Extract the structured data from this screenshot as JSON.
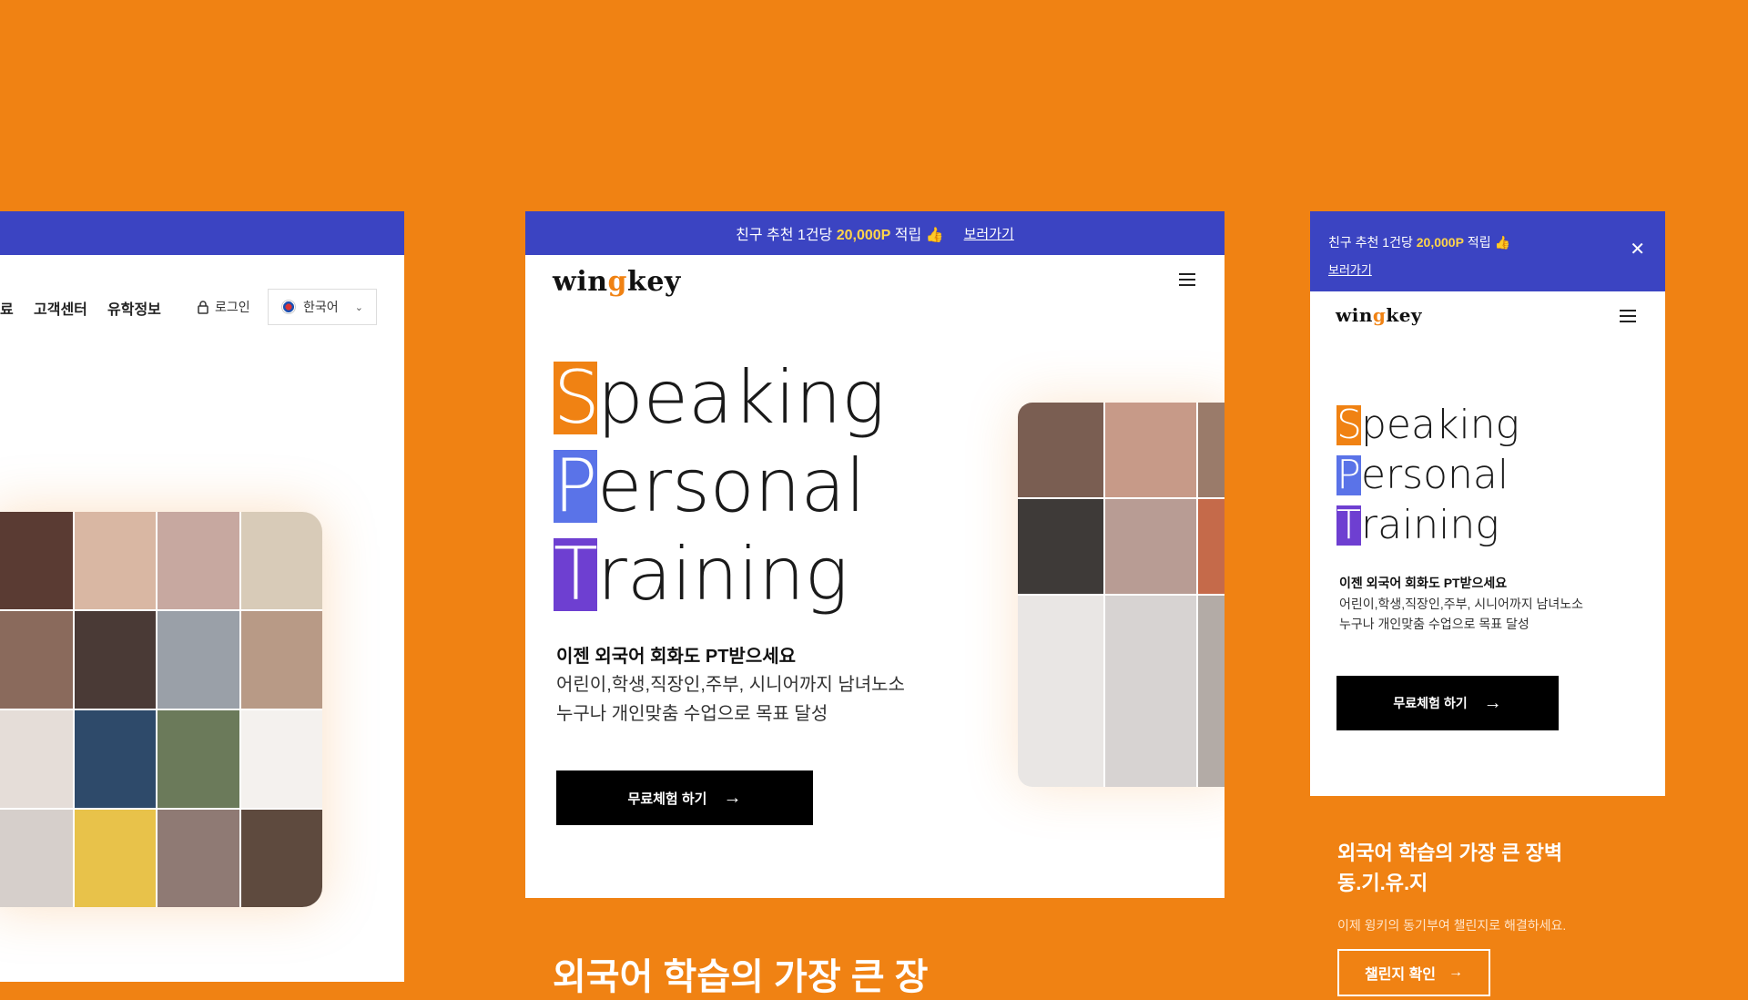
{
  "colors": {
    "accent_orange": "#F08213",
    "banner_blue": "#3B44C2",
    "cap_orange": "#F08213",
    "cap_blue": "#5A73E8",
    "cap_purple": "#6E3FD1",
    "highlight_yellow": "#FFD54A"
  },
  "left_panel": {
    "nav": [
      "료",
      "고객센터",
      "유학정보"
    ],
    "login_label": "로그인",
    "lang_label": "한국어"
  },
  "center_panel": {
    "banner": {
      "text_before": "친구 추천 1건당 ",
      "amount": "20,000P",
      "text_after": " 적립 👍",
      "link": "보러가기"
    },
    "logo": {
      "pre": "win",
      "mid": "g",
      "post": "key"
    },
    "hero": {
      "line1_cap": "S",
      "line1_rest": "peaking",
      "line2_cap": "P",
      "line2_rest": "ersonal",
      "line3_cap": "T",
      "line3_rest": "raining"
    },
    "subtitle": "이젠 외국어 회화도 PT받으세요",
    "desc1": "어린이,학생,직장인,주부, 시니어까지 남녀노소",
    "desc2": "누구나 개인맞춤 수업으로 목표 달성",
    "cta": "무료체험 하기",
    "bottom_title": "외국어 학습의 가장 큰 장"
  },
  "right_panel": {
    "banner": {
      "text_before": "친구 추천 1건당 ",
      "amount": "20,000P",
      "text_after": " 적립 👍",
      "link": "보러가기"
    },
    "logo": {
      "pre": "win",
      "mid": "g",
      "post": "key"
    },
    "hero": {
      "line1_cap": "S",
      "line1_rest": "peaking",
      "line2_cap": "P",
      "line2_rest": "ersonal",
      "line3_cap": "T",
      "line3_rest": "raining"
    },
    "subtitle": "이젠 외국어 회화도 PT받으세요",
    "desc1": "어린이,학생,직장인,주부, 시니어까지 남녀노소",
    "desc2": "누구나 개인맞춤 수업으로 목표 달성",
    "cta": "무료체험 하기",
    "orange_title1": "외국어 학습의 가장 큰 장벽",
    "orange_title2": "동.기.유.지",
    "orange_sub": "이제 윙키의 동기부여 챌린지로 해결하세요.",
    "challenge_btn": "챌린지 확인"
  }
}
